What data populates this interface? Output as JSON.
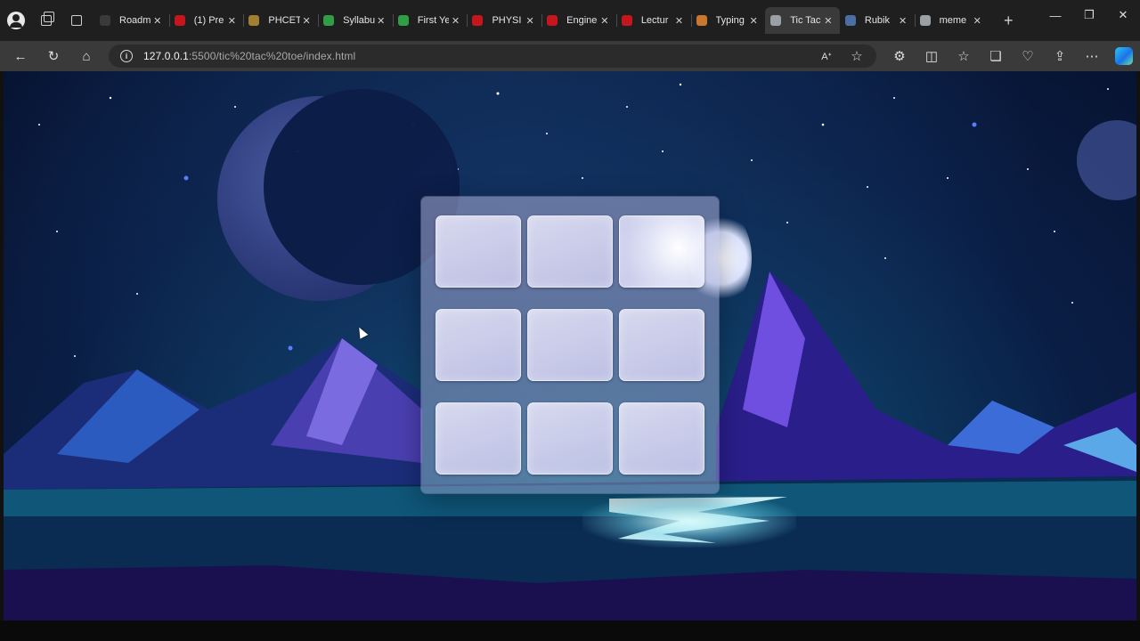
{
  "browser": {
    "tabs": [
      {
        "label": "Roadm",
        "favicon_color": "#3a3a3a",
        "active": false
      },
      {
        "label": "(1) Pre",
        "favicon_color": "#c4161c",
        "active": false
      },
      {
        "label": "PHCET",
        "favicon_color": "#a08030",
        "active": false
      },
      {
        "label": "Syllabu",
        "favicon_color": "#2f9e44",
        "active": false
      },
      {
        "label": "First Ye",
        "favicon_color": "#2f9e44",
        "active": false
      },
      {
        "label": "PHYSI",
        "favicon_color": "#c4161c",
        "active": false
      },
      {
        "label": "Engine",
        "favicon_color": "#c4161c",
        "active": false
      },
      {
        "label": "Lectur",
        "favicon_color": "#c4161c",
        "active": false
      },
      {
        "label": "Typing",
        "favicon_color": "#c9772f",
        "active": false
      },
      {
        "label": "Tic Tac",
        "favicon_color": "#9aa0a6",
        "active": true
      },
      {
        "label": "Rubik",
        "favicon_color": "#4a6fa5",
        "active": false
      },
      {
        "label": "meme",
        "favicon_color": "#9aa0a6",
        "active": false
      }
    ],
    "new_tab_symbol": "+",
    "url_host": "127.0.0.1",
    "url_rest": ":5500/tic%20tac%20toe/index.html",
    "window_controls": {
      "minimize": "—",
      "restore": "❐",
      "close": "✕"
    }
  },
  "game": {
    "board_cells": [
      "",
      "",
      "",
      "",
      "",
      "",
      "",
      "",
      ""
    ]
  }
}
